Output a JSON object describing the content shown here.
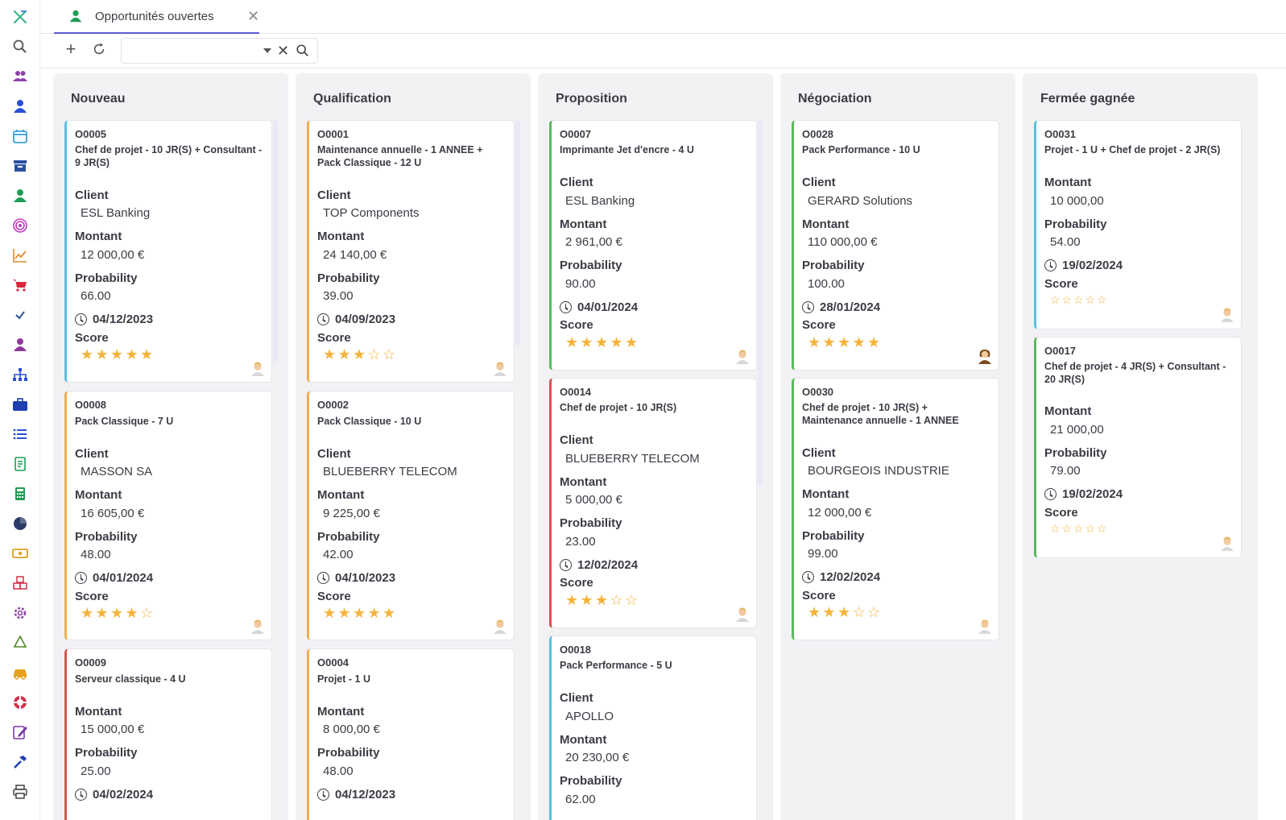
{
  "tab": {
    "label": "Opportunités ouvertes"
  },
  "toolbar": {
    "search_placeholder": ""
  },
  "labels": {
    "client": "Client",
    "montant": "Montant",
    "probability": "Probability",
    "score": "Score"
  },
  "colors": {
    "accent": "#5b5bd6",
    "star": "#f6b33b",
    "border_blue": "#5bc0de",
    "border_orange": "#f0ad4e",
    "border_green": "#5cb85c",
    "border_red": "#d9534f"
  },
  "sidebar_icons": [
    "app-logo-icon",
    "search-icon",
    "contacts-icon",
    "user-icon",
    "calendar-icon",
    "archive-icon",
    "user-green-icon",
    "target-icon",
    "chart-icon",
    "cart-icon",
    "check-icon",
    "user-purple-icon",
    "org-chart-icon",
    "briefcase-icon",
    "list-icon",
    "document-icon",
    "calculator-icon",
    "pie-chart-icon",
    "cash-icon",
    "boxes-icon",
    "gear-icon",
    "recycle-icon",
    "car-icon",
    "lifebuoy-icon",
    "edit-icon",
    "hammer-icon",
    "printer-icon"
  ],
  "columns": [
    {
      "title": "Nouveau",
      "cards": [
        {
          "ref": "O0005",
          "name": "Chef de projet - 10 JR(S) + Consultant - 9 JR(S)",
          "client": "ESL Banking",
          "montant": "12 000,00 €",
          "probability": "66.00",
          "date": "04/12/2023",
          "score": 5
        },
        {
          "ref": "O0008",
          "name": "Pack Classique - 7 U",
          "client": "MASSON SA",
          "montant": "16 605,00 €",
          "probability": "48.00",
          "date": "04/01/2024",
          "score": 4
        },
        {
          "ref": "O0009",
          "name": "Serveur classique - 4 U",
          "client": "",
          "montant": "15 000,00 €",
          "probability": "25.00",
          "date": "04/02/2024",
          "score": null
        }
      ]
    },
    {
      "title": "Qualification",
      "cards": [
        {
          "ref": "O0001",
          "name": "Maintenance annuelle - 1 ANNEE + Pack Classique - 12 U",
          "client": "TOP Components",
          "montant": "24 140,00 €",
          "probability": "39.00",
          "date": "04/09/2023",
          "score": 3
        },
        {
          "ref": "O0002",
          "name": "Pack Classique - 10 U",
          "client": "BLUEBERRY TELECOM",
          "montant": "9 225,00 €",
          "probability": "42.00",
          "date": "04/10/2023",
          "score": 5
        },
        {
          "ref": "O0004",
          "name": "Projet - 1 U",
          "client": "",
          "montant": "8 000,00 €",
          "probability": "48.00",
          "date": "04/12/2023",
          "score": null
        }
      ]
    },
    {
      "title": "Proposition",
      "cards": [
        {
          "ref": "O0007",
          "name": "Imprimante Jet d'encre - 4 U",
          "client": "ESL Banking",
          "montant": "2 961,00 €",
          "probability": "90.00",
          "date": "04/01/2024",
          "score": 5
        },
        {
          "ref": "O0014",
          "name": "Chef de projet - 10 JR(S)",
          "client": "BLUEBERRY TELECOM",
          "montant": "5 000,00 €",
          "probability": "23.00",
          "date": "12/02/2024",
          "score": 3
        },
        {
          "ref": "O0018",
          "name": "Pack Performance - 5 U",
          "client": "APOLLO",
          "montant": "20 230,00 €",
          "probability": "62.00",
          "date": "",
          "score": null
        }
      ]
    },
    {
      "title": "Négociation",
      "cards": [
        {
          "ref": "O0028",
          "name": "Pack Performance - 10 U",
          "client": "GERARD Solutions",
          "montant": "110 000,00 €",
          "probability": "100.00",
          "date": "28/01/2024",
          "score": 5
        },
        {
          "ref": "O0030",
          "name": "Chef de projet - 10 JR(S) + Maintenance annuelle - 1 ANNEE",
          "client": "BOURGEOIS INDUSTRIE",
          "montant": "12 000,00 €",
          "probability": "99.00",
          "date": "12/02/2024",
          "score": 3
        }
      ]
    },
    {
      "title": "Fermée gagnée",
      "cards": [
        {
          "ref": "O0031",
          "name": "Projet - 1 U + Chef de projet - 2 JR(S)",
          "client": "",
          "montant": "10 000,00",
          "probability": "54.00",
          "date": "19/02/2024",
          "score": 0
        },
        {
          "ref": "O0017",
          "name": "Chef de projet - 4 JR(S) + Consultant - 20 JR(S)",
          "client": "",
          "montant": "21 000,00",
          "probability": "79.00",
          "date": "19/02/2024",
          "score": 0
        }
      ]
    }
  ]
}
